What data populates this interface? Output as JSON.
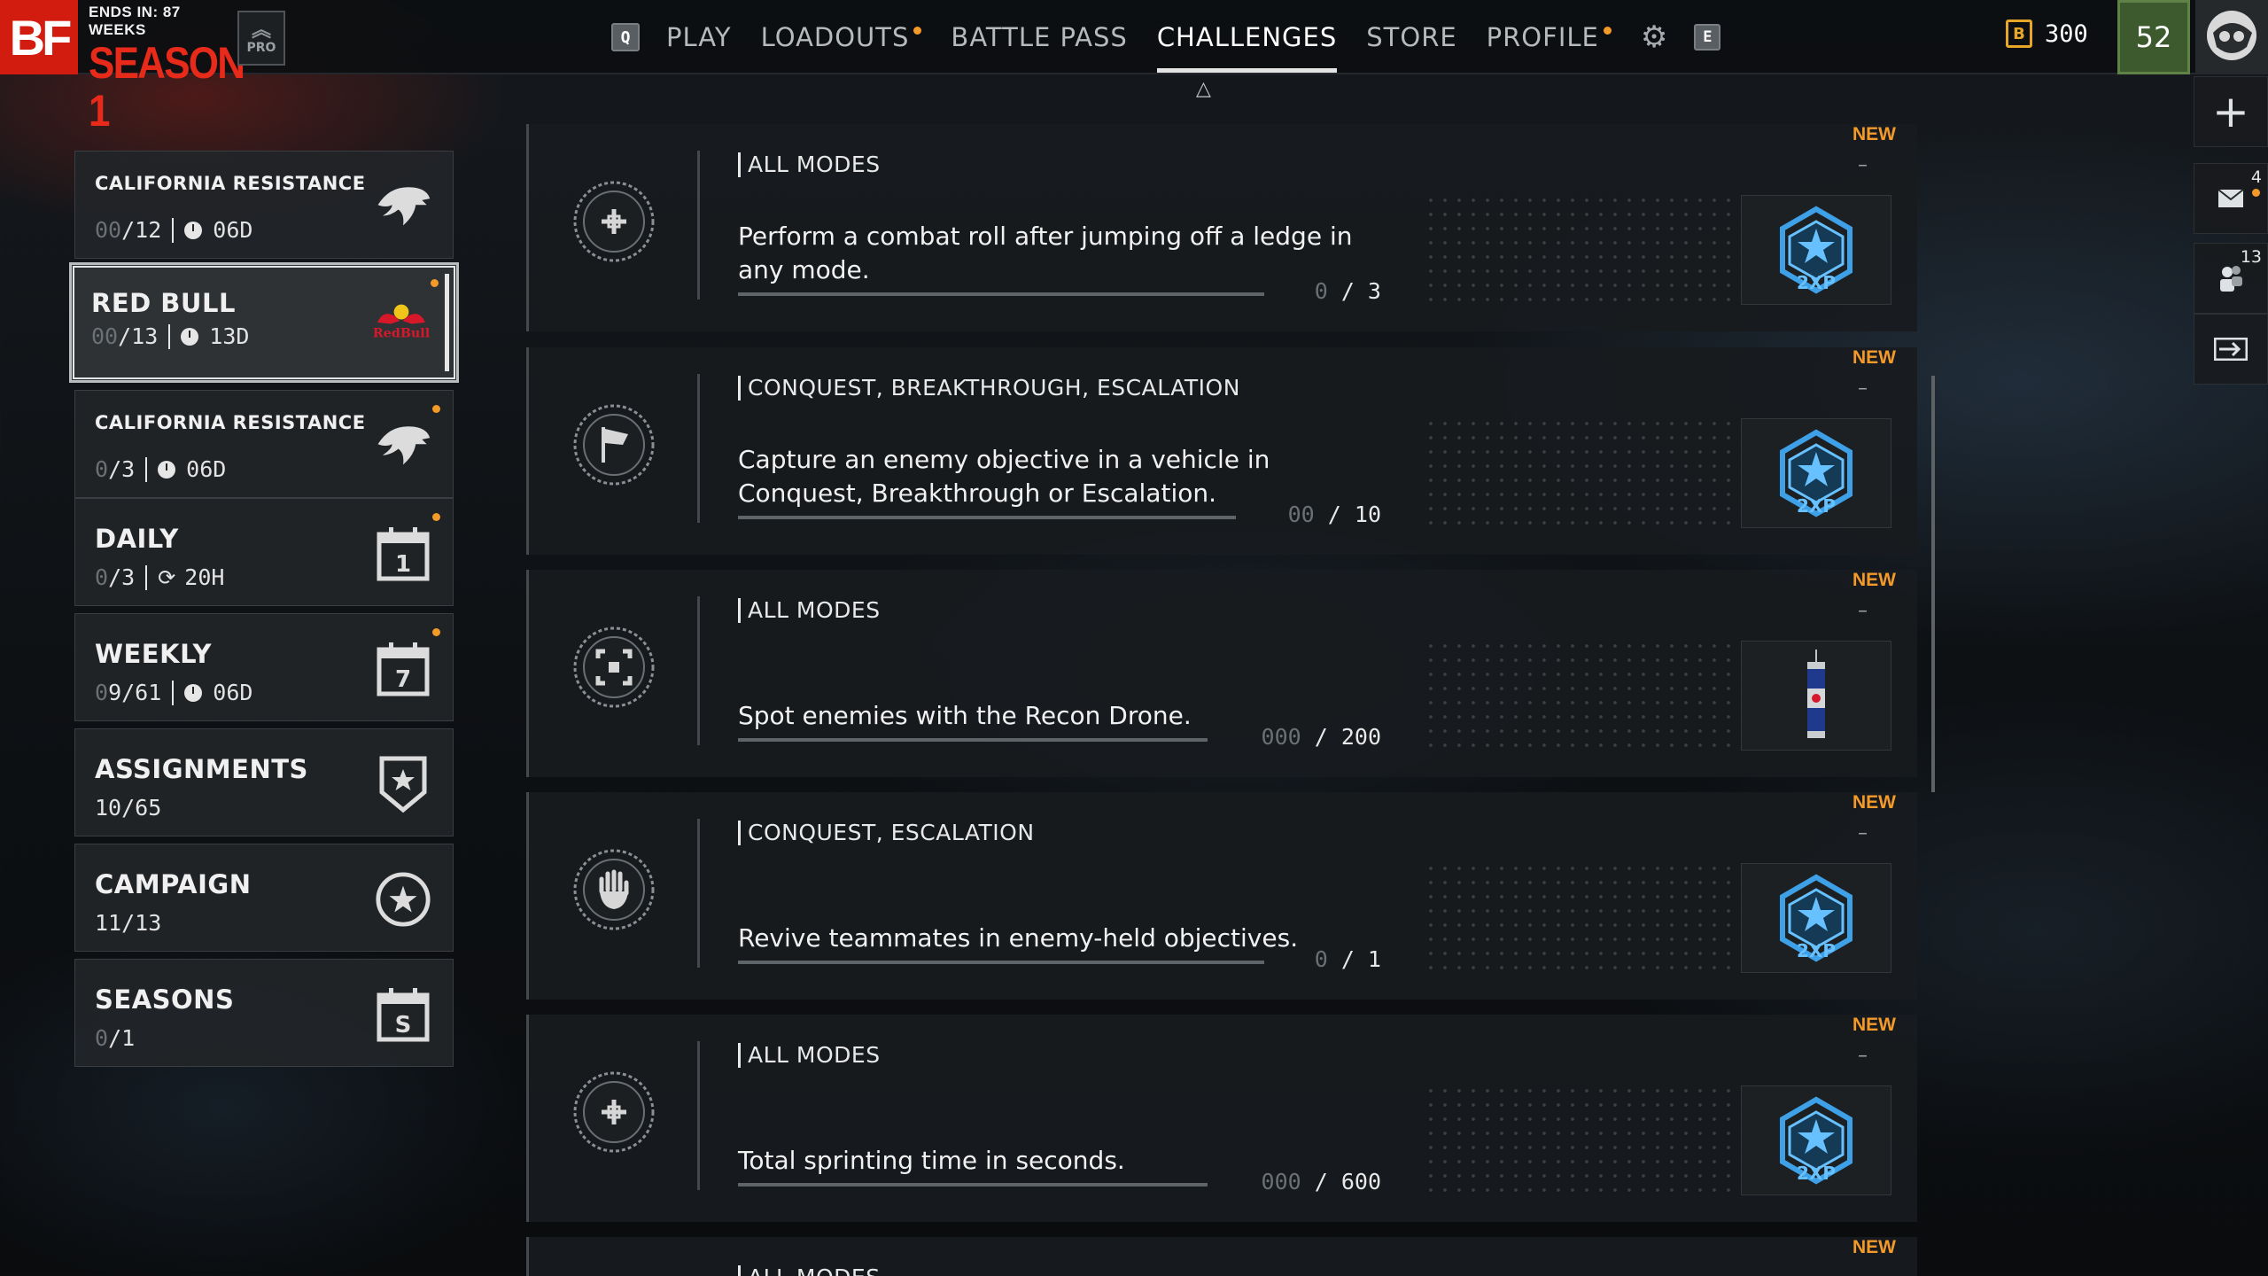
{
  "header": {
    "logo": "BF",
    "season_sub": "ENDS IN: 87 WEEKS",
    "season_title": "SEASON 1",
    "pro_label": "PRO",
    "nav_key_left": "Q",
    "nav_key_right": "E",
    "nav": [
      {
        "label": "PLAY",
        "dot": false,
        "active": false
      },
      {
        "label": "LOADOUTS",
        "dot": true,
        "active": false
      },
      {
        "label": "BATTLE PASS",
        "dot": false,
        "active": false
      },
      {
        "label": "CHALLENGES",
        "dot": false,
        "active": true
      },
      {
        "label": "STORE",
        "dot": false,
        "active": false
      },
      {
        "label": "PROFILE",
        "dot": true,
        "active": false
      }
    ],
    "currency": "300",
    "currency_icon": "B",
    "level": "52"
  },
  "rail": {
    "mail_count": "4",
    "friends_count": "13"
  },
  "categories": [
    {
      "title": "CALIFORNIA RESISTANCE",
      "zero": "00",
      "count": "/12",
      "time": "06D",
      "time_icon": "clock-icon",
      "icon": "eagle-icon",
      "dot": false,
      "selected": false
    },
    {
      "title": "RED BULL",
      "zero": "00",
      "count": "/13",
      "time": "13D",
      "time_icon": "clock-icon",
      "icon": "redbull-logo",
      "dot": true,
      "selected": true
    },
    {
      "title": "CALIFORNIA RESISTANCE",
      "zero": "0",
      "count": "/3",
      "time": "06D",
      "time_icon": "clock-icon",
      "icon": "eagle-icon",
      "dot": true,
      "selected": false
    },
    {
      "title": "DAILY",
      "zero": "0",
      "count": "/3",
      "time": "20H",
      "time_icon": "refresh-icon",
      "icon": "calendar-1-icon",
      "icon_text": "1",
      "dot": true,
      "selected": false
    },
    {
      "title": "WEEKLY",
      "zero": "0",
      "count": "9/61",
      "time": "06D",
      "time_icon": "clock-icon",
      "icon": "calendar-7-icon",
      "icon_text": "7",
      "dot": true,
      "selected": false
    },
    {
      "title": "ASSIGNMENTS",
      "zero": "",
      "count": "10/65",
      "time": "",
      "icon": "shield-star-icon",
      "dot": false,
      "selected": false
    },
    {
      "title": "CAMPAIGN",
      "zero": "",
      "count": "11/13",
      "time": "",
      "icon": "star-circle-icon",
      "dot": false,
      "selected": false
    },
    {
      "title": "SEASONS",
      "zero": "0",
      "count": "/1",
      "time": "",
      "icon": "calendar-s-icon",
      "icon_text": "S",
      "dot": false,
      "selected": false
    }
  ],
  "challenges": [
    {
      "modes": "ALL MODES",
      "desc": "Perform a combat roll after jumping off a ledge in any mode.",
      "zero": "0",
      "progress": " / 3",
      "emblem": "crosshair-emblem-icon",
      "reward": "2xp",
      "reward_text": "2XP",
      "new": "NEW",
      "dash": "–"
    },
    {
      "modes": "CONQUEST, BREAKTHROUGH, ESCALATION",
      "desc": "Capture an enemy objective in a vehicle in Conquest, Breakthrough or Escalation.",
      "zero": "00",
      "progress": " / 10",
      "emblem": "flag-emblem-icon",
      "reward": "2xp",
      "reward_text": "2XP",
      "new": "NEW",
      "dash": "–"
    },
    {
      "modes": "ALL MODES",
      "desc": "Spot enemies with the Recon Drone.",
      "zero": "000",
      "progress": " / 200",
      "emblem": "spot-emblem-icon",
      "reward": "can",
      "reward_text": "",
      "new": "NEW",
      "dash": "–"
    },
    {
      "modes": "CONQUEST, ESCALATION",
      "desc": "Revive teammates in enemy-held objectives.",
      "zero": "0",
      "progress": " / 1",
      "emblem": "hand-emblem-icon",
      "reward": "2xp",
      "reward_text": "2XP",
      "new": "NEW",
      "dash": "–"
    },
    {
      "modes": "ALL MODES",
      "desc": "Total sprinting time in seconds.",
      "zero": "000",
      "progress": " / 600",
      "emblem": "crosshair-emblem-icon",
      "reward": "2xp",
      "reward_text": "2XP",
      "new": "NEW",
      "dash": "–"
    },
    {
      "modes": "ALL MODES",
      "desc": "",
      "zero": "",
      "progress": "",
      "emblem": "",
      "reward": "",
      "reward_text": "",
      "new": "NEW",
      "dash": ""
    }
  ]
}
